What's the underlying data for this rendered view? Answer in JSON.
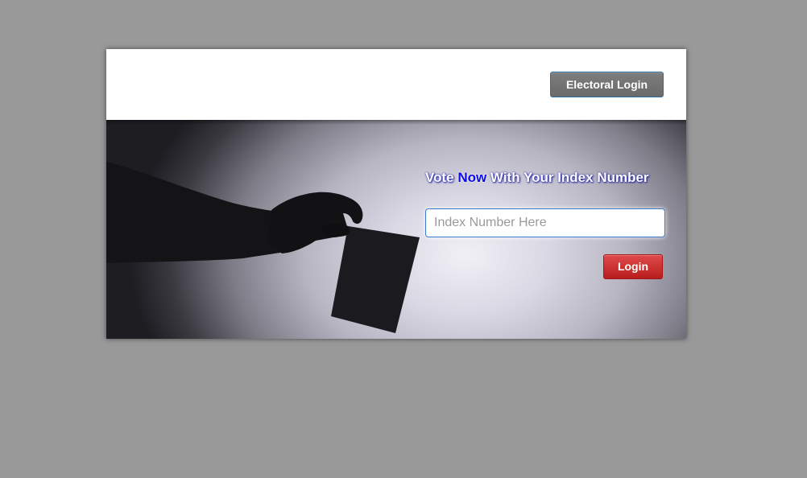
{
  "header": {
    "electoral_login_label": "Electoral Login"
  },
  "hero": {
    "image_name": "ballot-hand-silhouette",
    "title_part1": "Vote ",
    "title_highlight": "Now",
    "title_part2": " With Your Index Number",
    "highlight_color": "#0a0ae8"
  },
  "form": {
    "index_placeholder": "Index Number Here",
    "index_value": "",
    "login_label": "Login",
    "login_color": "#c62a2a"
  }
}
